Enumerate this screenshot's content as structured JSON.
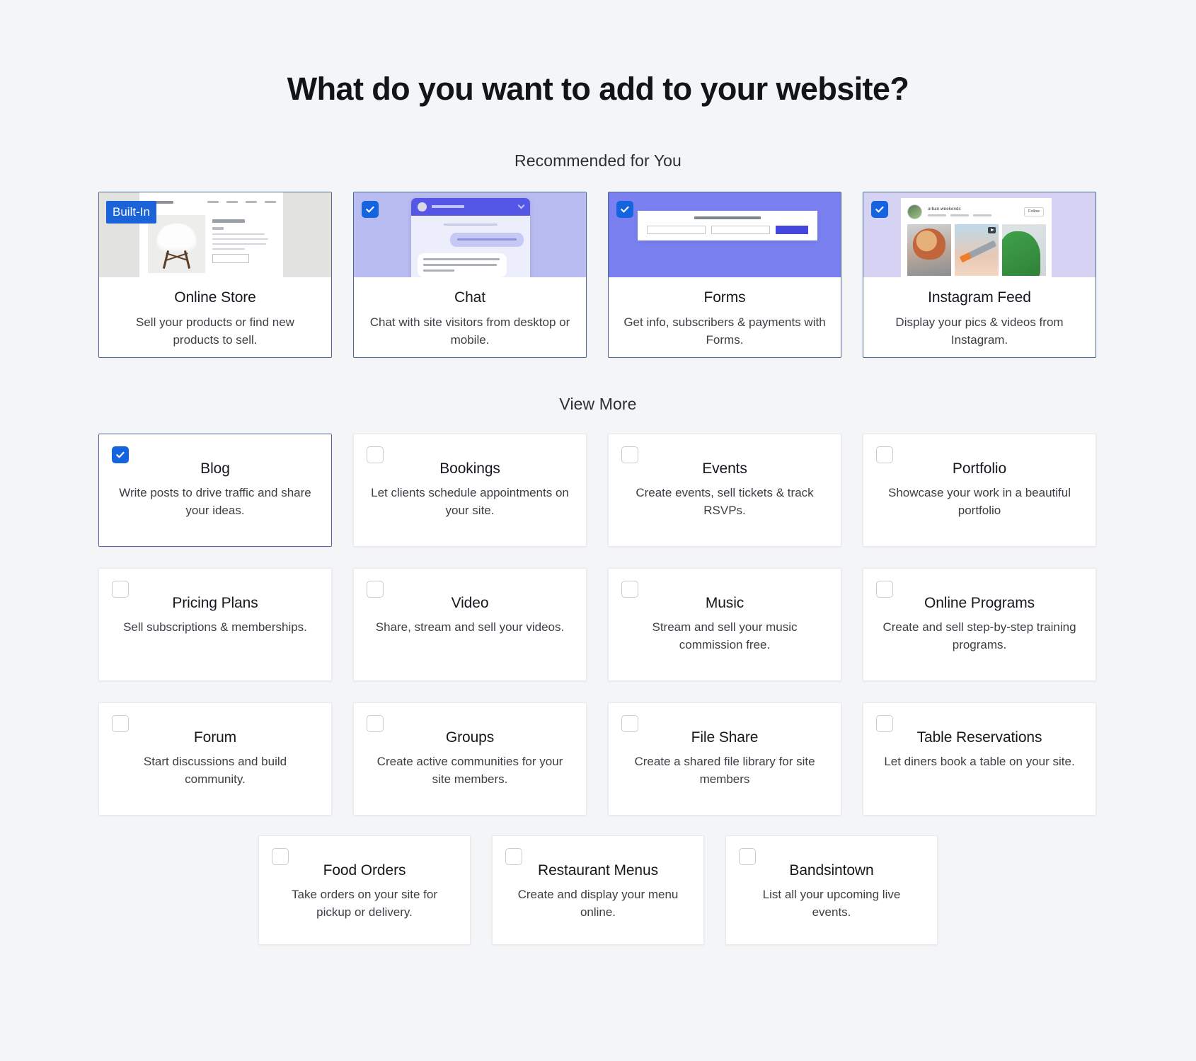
{
  "header": {
    "title": "What do you want to add to your website?"
  },
  "sections": {
    "recommended_label": "Recommended for You",
    "view_more_label": "View More"
  },
  "colors": {
    "accent_blue": "#1464e0",
    "badge_blue": "#1b63d8",
    "selected_border": "#4a6c96",
    "page_background": "#f4f5f7",
    "card_background": "#ffffff"
  },
  "recommended": [
    {
      "title": "Online Store",
      "description": "Sell your products or find new products to sell.",
      "badge": "Built-In",
      "has_badge": true,
      "has_checkbox": false,
      "checked": false,
      "selected": true,
      "thumb": "online-store-preview"
    },
    {
      "title": "Chat",
      "description": "Chat with site visitors from desktop or mobile.",
      "badge": "",
      "has_badge": false,
      "has_checkbox": true,
      "checked": true,
      "selected": true,
      "thumb": "chat-widget-preview"
    },
    {
      "title": "Forms",
      "description": "Get info, subscribers & payments with Forms.",
      "badge": "",
      "has_badge": false,
      "has_checkbox": true,
      "checked": true,
      "selected": true,
      "thumb": "forms-preview"
    },
    {
      "title": "Instagram Feed",
      "description": "Display your pics & videos from Instagram.",
      "badge": "",
      "has_badge": false,
      "has_checkbox": true,
      "checked": true,
      "selected": true,
      "thumb": "instagram-feed-preview"
    }
  ],
  "instagram_preview": {
    "account_name": "urban.weekends",
    "follow_label": "Follow"
  },
  "view_more": [
    {
      "title": "Blog",
      "description": "Write posts to drive traffic and share your ideas.",
      "checked": true,
      "selected": true
    },
    {
      "title": "Bookings",
      "description": "Let clients schedule appointments on your site.",
      "checked": false,
      "selected": false
    },
    {
      "title": "Events",
      "description": "Create events, sell tickets & track RSVPs.",
      "checked": false,
      "selected": false
    },
    {
      "title": "Portfolio",
      "description": "Showcase your work in a beautiful portfolio",
      "checked": false,
      "selected": false
    },
    {
      "title": "Pricing Plans",
      "description": "Sell subscriptions & memberships.",
      "checked": false,
      "selected": false
    },
    {
      "title": "Video",
      "description": "Share, stream and sell your videos.",
      "checked": false,
      "selected": false
    },
    {
      "title": "Music",
      "description": "Stream and sell your music commission free.",
      "checked": false,
      "selected": false
    },
    {
      "title": "Online Programs",
      "description": "Create and sell step-by-step training programs.",
      "checked": false,
      "selected": false
    },
    {
      "title": "Forum",
      "description": "Start discussions and build community.",
      "checked": false,
      "selected": false
    },
    {
      "title": "Groups",
      "description": "Create active communities for your site members.",
      "checked": false,
      "selected": false
    },
    {
      "title": "File Share",
      "description": "Create a shared file library for site members",
      "checked": false,
      "selected": false
    },
    {
      "title": "Table Reservations",
      "description": "Let diners book a table on your site.",
      "checked": false,
      "selected": false
    }
  ],
  "view_more_last_row": [
    {
      "title": "Food Orders",
      "description": "Take orders on your site for pickup or delivery.",
      "checked": false,
      "selected": false
    },
    {
      "title": "Restaurant Menus",
      "description": "Create and display your menu online.",
      "checked": false,
      "selected": false
    },
    {
      "title": "Bandsintown",
      "description": "List all your upcoming live events.",
      "checked": false,
      "selected": false
    }
  ]
}
